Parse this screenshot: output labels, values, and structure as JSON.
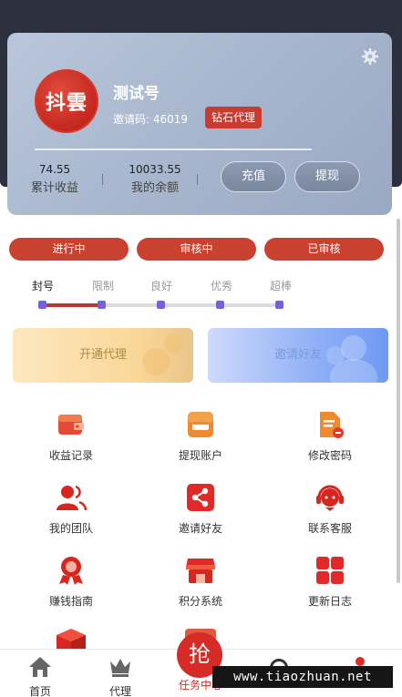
{
  "profile": {
    "avatar_text": "抖雲",
    "username": "测试号",
    "invite_code": "邀请码: 46019",
    "vip_level": "钻石代理",
    "stats": [
      {
        "value": "74.55",
        "label": "累计收益"
      },
      {
        "value": "10033.55",
        "label": "我的余额"
      }
    ],
    "recharge_label": "充值",
    "withdraw_label": "提现"
  },
  "status_tabs": [
    "进行中",
    "审核中",
    "已审核"
  ],
  "levels": {
    "labels": [
      "封号",
      "限制",
      "良好",
      "优秀",
      "超棒"
    ],
    "current_index": 1
  },
  "promos": {
    "agent_label": "开通代理",
    "invite_label": "邀请好友"
  },
  "menu": [
    {
      "label": "收益记录",
      "icon": "wallet-icon"
    },
    {
      "label": "提现账户",
      "icon": "card-icon"
    },
    {
      "label": "修改密码",
      "icon": "document-icon"
    },
    {
      "label": "我的团队",
      "icon": "team-icon"
    },
    {
      "label": "邀请好友",
      "icon": "share-icon"
    },
    {
      "label": "联系客服",
      "icon": "headset-icon"
    },
    {
      "label": "赚钱指南",
      "icon": "award-icon"
    },
    {
      "label": "积分系统",
      "icon": "shop-icon"
    },
    {
      "label": "更新日志",
      "icon": "grid-icon"
    }
  ],
  "tabbar": {
    "home": "首页",
    "agent": "代理",
    "task_center": "任务中心",
    "task_center_icon_text": "抢"
  },
  "watermark": "www.tiaozhuan.net",
  "colors": {
    "accent": "#c9412f",
    "level_dot": "#7462d8",
    "tab_active": "#d62b26"
  }
}
